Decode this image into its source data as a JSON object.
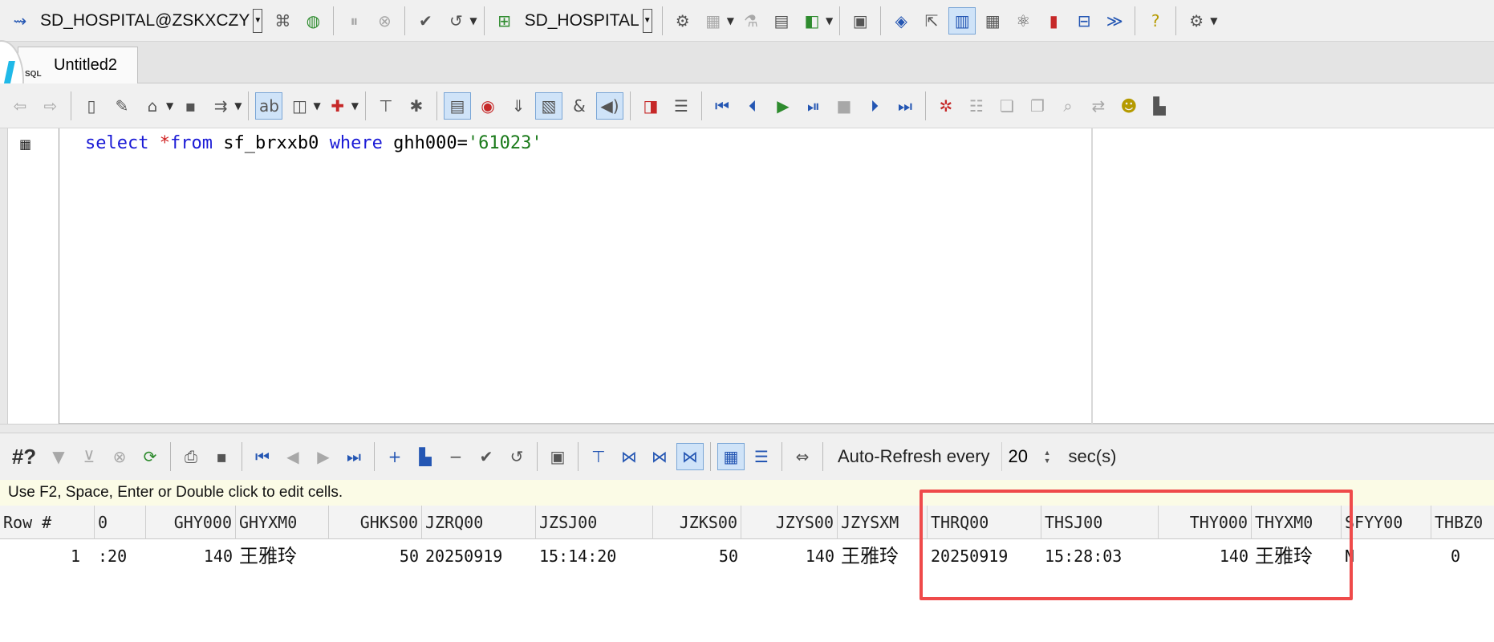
{
  "toolbar": {
    "session": "SD_HOSPITAL@ZSKXCZY",
    "database": "SD_HOSPITAL"
  },
  "tabs": [
    {
      "label": "Untitled2",
      "icon_text": "SQL"
    }
  ],
  "editor": {
    "sql": {
      "select": "select",
      "star": "*",
      "from": "from",
      "table": "sf_brxxb0",
      "where": "where",
      "column": "ghh000",
      "eq": "=",
      "value": "'61023'"
    }
  },
  "results_toolbar": {
    "record_label": "#?",
    "auto_refresh_label": "Auto-Refresh every",
    "refresh_value": "20",
    "unit": "sec(s)"
  },
  "hint": "Use F2, Space, Enter or Double click to edit cells.",
  "grid": {
    "columns": [
      "Row #",
      "0",
      "GHY000",
      "GHYXM0",
      "GHKS00",
      "JZRQ00",
      "JZSJ00",
      "JZKS00",
      "JZYS00",
      "JZYSXM",
      "THRQ00",
      "THSJ00",
      "THY000",
      "THYXM0",
      "SFYY00",
      "THBZ0"
    ],
    "rows": [
      [
        "1",
        ":20",
        "140",
        "王雅玲",
        "50",
        "20250919",
        "15:14:20",
        "50",
        "140",
        "王雅玲",
        "20250919",
        "15:28:03",
        "140",
        "王雅玲",
        "N",
        "0"
      ]
    ]
  },
  "colors": {
    "keyword": "#1a1ad6",
    "string": "#1a7a1a",
    "highlight_box": "#ef4a4a"
  }
}
